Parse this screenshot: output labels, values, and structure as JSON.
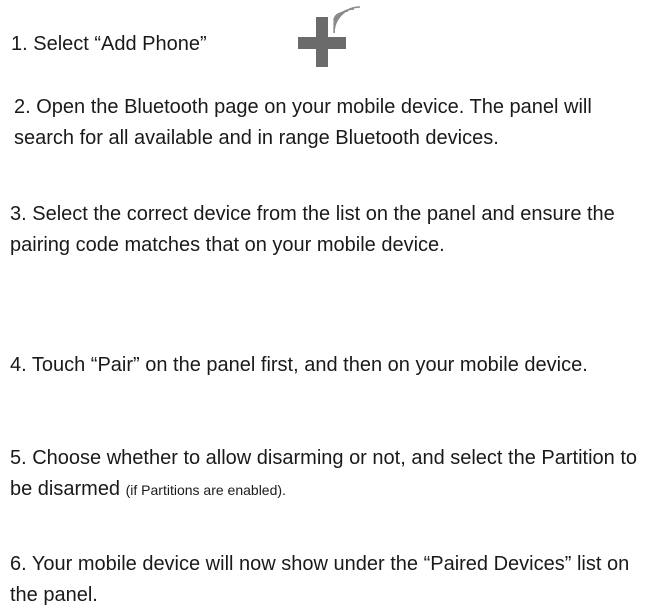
{
  "steps": [
    {
      "text": "1. Select “Add Phone”"
    },
    {
      "text": "2. Open the Bluetooth page on your mobile device.  The panel will search for all available and in range Bluetooth devices."
    },
    {
      "text": "3. Select the correct device from the list on the panel and ensure the pairing code matches that on your mobile device."
    },
    {
      "text": "4. Touch “Pair” on the panel first, and then on your mobile device."
    },
    {
      "text": "5. Choose whether to allow disarming or not, and select the Partition to be disarmed ",
      "note": "(if Partitions are enabled)."
    },
    {
      "text": "6.  Your mobile device will now show under the “Paired Devices” list on the panel."
    }
  ],
  "icons": {
    "add_phone": "add-phone-plus-signal-icon"
  },
  "colors": {
    "text": "#1a1a1a",
    "icon": "#6b6b6b"
  }
}
